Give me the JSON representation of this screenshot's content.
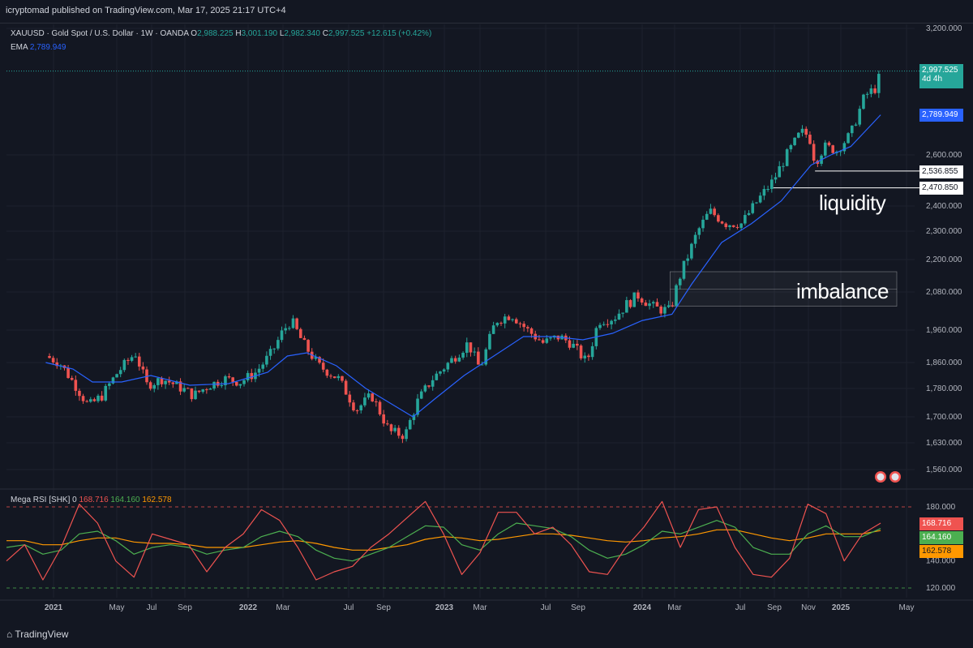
{
  "header": {
    "published_text": "icryptomad published on TradingView.com, Mar 17, 2025 21:17 UTC+4"
  },
  "legend": {
    "symbol_text": "XAUUSD · Gold Spot / U.S. Dollar · 1W · OANDA",
    "o_label": "O",
    "o_value": "2,988.225",
    "h_label": "H",
    "h_value": "3,001.190",
    "l_label": "L",
    "l_value": "2,982.340",
    "c_label": "C",
    "c_value": "2,997.525",
    "change": "+12.615 (+0.42%)",
    "ema_label": "EMA",
    "ema_value": "2,789.949"
  },
  "rsi_legend": {
    "name": "Mega RSI [SHK]",
    "param": "0",
    "v1": "168.716",
    "v2": "164.160",
    "v3": "162.578"
  },
  "price_tags": {
    "last": "2,997.525",
    "countdown": "4d 4h",
    "ema": "2,789.949",
    "level1": "2,536.855",
    "level2": "2,470.850"
  },
  "rsi_tags": {
    "t1": "168.716",
    "t2": "164.160",
    "t3": "162.578"
  },
  "annotations": {
    "liquidity": "liquidity",
    "imbalance": "imbalance"
  },
  "footer": {
    "brand": "TradingView"
  },
  "colors": {
    "bg": "#131722",
    "up": "#26a69a",
    "down": "#ef5350",
    "ema": "#2962ff",
    "rsi": "#ef5350",
    "rsi_fast": "#4caf50",
    "rsi_slow": "#ff9800",
    "grid": "#1e222d"
  },
  "chart_data": {
    "type": "candlestick",
    "symbol": "XAUUSD",
    "timeframe": "1W",
    "y_axis": {
      "ticks": [
        "3,200.000",
        "2,600.000",
        "2,400.000",
        "2,300.000",
        "2,200.000",
        "2,080.000",
        "1,960.000",
        "1,860.000",
        "1,780.000",
        "1,700.000",
        "1,630.000",
        "1,560.000"
      ],
      "ylim": [
        1530,
        3220
      ]
    },
    "x_axis": {
      "ticks": [
        "2021",
        "May",
        "Jul",
        "Sep",
        "2022",
        "Mar",
        "Jul",
        "Sep",
        "2023",
        "Mar",
        "Jul",
        "Sep",
        "2024",
        "Mar",
        "Jul",
        "Sep",
        "Nov",
        "2025",
        "May"
      ]
    },
    "price_path": [
      [
        2020.96,
        1880
      ],
      [
        2021.03,
        1860
      ],
      [
        2021.1,
        1800
      ],
      [
        2021.18,
        1730
      ],
      [
        2021.25,
        1760
      ],
      [
        2021.33,
        1830
      ],
      [
        2021.42,
        1890
      ],
      [
        2021.48,
        1790
      ],
      [
        2021.56,
        1810
      ],
      [
        2021.63,
        1790
      ],
      [
        2021.72,
        1760
      ],
      [
        2021.8,
        1790
      ],
      [
        2021.88,
        1810
      ],
      [
        2021.96,
        1800
      ],
      [
        2022.04,
        1830
      ],
      [
        2022.12,
        1890
      ],
      [
        2022.18,
        1960
      ],
      [
        2022.22,
        1990
      ],
      [
        2022.28,
        1920
      ],
      [
        2022.36,
        1850
      ],
      [
        2022.46,
        1810
      ],
      [
        2022.55,
        1720
      ],
      [
        2022.63,
        1760
      ],
      [
        2022.72,
        1660
      ],
      [
        2022.8,
        1650
      ],
      [
        2022.86,
        1740
      ],
      [
        2022.94,
        1810
      ],
      [
        2023.04,
        1870
      ],
      [
        2023.12,
        1920
      ],
      [
        2023.18,
        1840
      ],
      [
        2023.26,
        1990
      ],
      [
        2023.34,
        2010
      ],
      [
        2023.42,
        1960
      ],
      [
        2023.5,
        1920
      ],
      [
        2023.58,
        1940
      ],
      [
        2023.64,
        1920
      ],
      [
        2023.72,
        1860
      ],
      [
        2023.78,
        1990
      ],
      [
        2023.86,
        2000
      ],
      [
        2023.92,
        2040
      ],
      [
        2023.98,
        2070
      ],
      [
        2024.06,
        2030
      ],
      [
        2024.14,
        2020
      ],
      [
        2024.2,
        2160
      ],
      [
        2024.28,
        2300
      ],
      [
        2024.34,
        2380
      ],
      [
        2024.42,
        2330
      ],
      [
        2024.5,
        2330
      ],
      [
        2024.58,
        2420
      ],
      [
        2024.66,
        2500
      ],
      [
        2024.74,
        2620
      ],
      [
        2024.8,
        2710
      ],
      [
        2024.84,
        2690
      ],
      [
        2024.87,
        2570
      ],
      [
        2024.92,
        2640
      ],
      [
        2024.98,
        2620
      ],
      [
        2025.05,
        2700
      ],
      [
        2025.12,
        2880
      ],
      [
        2025.18,
        2920
      ],
      [
        2025.2,
        2997
      ]
    ],
    "ema_path": [
      [
        2020.96,
        1860
      ],
      [
        2021.1,
        1840
      ],
      [
        2021.2,
        1800
      ],
      [
        2021.35,
        1800
      ],
      [
        2021.5,
        1820
      ],
      [
        2021.7,
        1790
      ],
      [
        2021.9,
        1795
      ],
      [
        2022.1,
        1830
      ],
      [
        2022.2,
        1880
      ],
      [
        2022.3,
        1890
      ],
      [
        2022.45,
        1850
      ],
      [
        2022.6,
        1780
      ],
      [
        2022.75,
        1730
      ],
      [
        2022.84,
        1700
      ],
      [
        2022.95,
        1750
      ],
      [
        2023.1,
        1820
      ],
      [
        2023.25,
        1880
      ],
      [
        2023.4,
        1940
      ],
      [
        2023.55,
        1940
      ],
      [
        2023.7,
        1930
      ],
      [
        2023.85,
        1950
      ],
      [
        2024.0,
        1990
      ],
      [
        2024.15,
        2010
      ],
      [
        2024.25,
        2110
      ],
      [
        2024.4,
        2260
      ],
      [
        2024.55,
        2330
      ],
      [
        2024.7,
        2420
      ],
      [
        2024.85,
        2560
      ],
      [
        2024.95,
        2600
      ],
      [
        2025.05,
        2640
      ],
      [
        2025.2,
        2790
      ]
    ],
    "levels": [
      {
        "name": "level-2536",
        "value": 2536.855
      },
      {
        "name": "level-2470",
        "value": 2470.85
      }
    ],
    "rsi": {
      "ticks": [
        "180.000",
        "140.000",
        "120.000"
      ],
      "upper_band": 180,
      "lower_band": 120,
      "series": [
        {
          "name": "rsi",
          "values": [
            140,
            152,
            126,
            150,
            182,
            168,
            140,
            128,
            160,
            156,
            152,
            132,
            150,
            160,
            178,
            170,
            150,
            126,
            132,
            136,
            150,
            160,
            172,
            184,
            160,
            130,
            146,
            176,
            176,
            160,
            165,
            152,
            132,
            130,
            150,
            165,
            184,
            150,
            178,
            180,
            150,
            130,
            128,
            142,
            182,
            175,
            140,
            160,
            168
          ]
        },
        {
          "name": "fast",
          "values": [
            150,
            152,
            145,
            148,
            160,
            162,
            155,
            145,
            150,
            152,
            150,
            145,
            148,
            150,
            158,
            162,
            158,
            148,
            142,
            140,
            145,
            150,
            158,
            166,
            165,
            152,
            148,
            160,
            168,
            166,
            164,
            158,
            148,
            142,
            145,
            152,
            162,
            160,
            165,
            170,
            165,
            150,
            145,
            145,
            160,
            166,
            158,
            158,
            164
          ]
        },
        {
          "name": "slow",
          "values": [
            155,
            155,
            152,
            152,
            155,
            157,
            157,
            154,
            153,
            153,
            152,
            150,
            150,
            150,
            152,
            154,
            155,
            153,
            150,
            148,
            148,
            150,
            152,
            156,
            158,
            157,
            155,
            156,
            158,
            160,
            160,
            159,
            157,
            155,
            154,
            155,
            157,
            158,
            160,
            163,
            163,
            160,
            157,
            155,
            157,
            160,
            160,
            160,
            162.5
          ]
        }
      ]
    }
  }
}
